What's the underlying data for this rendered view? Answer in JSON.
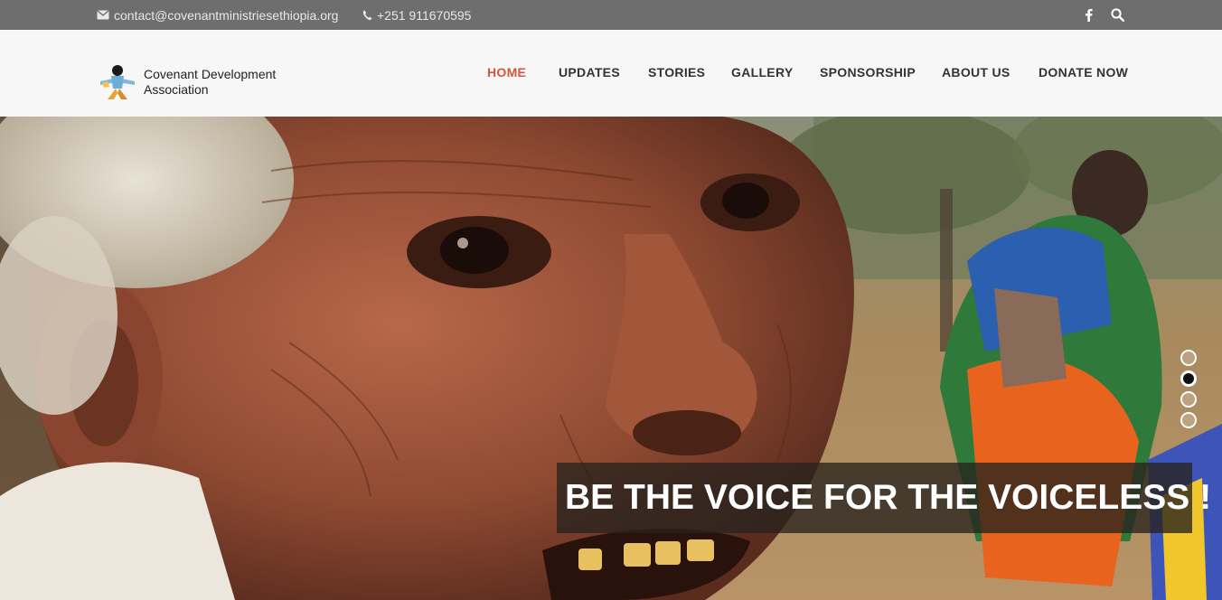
{
  "topbar": {
    "email": "contact@covenantministriesethiopia.org",
    "phone": "+251 911670595",
    "icons": [
      "envelope-icon",
      "phone-icon",
      "facebook-icon",
      "search-icon"
    ]
  },
  "header": {
    "logo_line1": "Covenant Development",
    "logo_line2": "Association",
    "nav": [
      {
        "label": "HOME",
        "active": true
      },
      {
        "label": "UPDATES",
        "active": false
      },
      {
        "label": "STORIES",
        "active": false
      },
      {
        "label": "GALLERY",
        "active": false
      },
      {
        "label": "SPONSORSHIP",
        "active": false
      },
      {
        "label": "ABOUT US",
        "active": false
      },
      {
        "label": "DONATE NOW",
        "active": false
      }
    ]
  },
  "hero": {
    "caption": "BE THE VOICE FOR THE VOICELESS !",
    "slides_total": 4,
    "active_slide": 2
  },
  "colors": {
    "topbar_bg": "#6e6e6e",
    "header_bg": "#f7f7f7",
    "nav_active": "#d9533a",
    "nav_text": "#333333"
  }
}
